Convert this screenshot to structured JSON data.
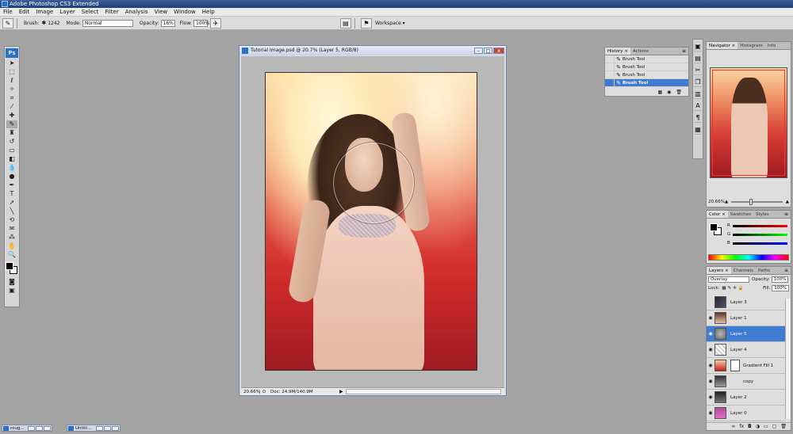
{
  "app": {
    "title": "Adobe Photoshop CS3 Extended"
  },
  "menu": [
    "File",
    "Edit",
    "Image",
    "Layer",
    "Select",
    "Filter",
    "Analysis",
    "View",
    "Window",
    "Help"
  ],
  "options": {
    "brush_label": "Brush:",
    "brush_size": "1242",
    "mode_label": "Mode:",
    "mode_value": "Normal",
    "opacity_label": "Opacity:",
    "opacity_value": "16%",
    "flow_label": "Flow:",
    "flow_value": "100%",
    "workspace_label": "Workspace ▾"
  },
  "toolbox": {
    "logo": "Ps"
  },
  "document": {
    "title": "Tutorial Image.psd @ 20.7% (Layer 5, RGB/8)",
    "zoom": "20.66%",
    "doc_size": "Doc: 24.9M/140.9M",
    "btn_min": "–",
    "btn_max": "□",
    "btn_close": "x"
  },
  "history": {
    "tabs": [
      "History ×",
      "Actions"
    ],
    "items": [
      {
        "label": "Brush Tool",
        "selected": false
      },
      {
        "label": "Brush Tool",
        "selected": false
      },
      {
        "label": "Brush Tool",
        "selected": false
      },
      {
        "label": "Brush Tool",
        "selected": true
      }
    ]
  },
  "navigator": {
    "tabs": [
      "Navigator ×",
      "Histogram",
      "Info"
    ],
    "zoom": "20.66%"
  },
  "color": {
    "tabs": [
      "Color ×",
      "Swatches",
      "Styles"
    ],
    "channels": [
      "R",
      "G",
      "B"
    ]
  },
  "layers": {
    "tabs": [
      "Layers ×",
      "Channels",
      "Paths"
    ],
    "blend_mode": "Overlay",
    "opacity_label": "Opacity:",
    "opacity_value": "100%",
    "lock_label": "Lock:",
    "fill_label": "Fill:",
    "fill_value": "100%",
    "items": [
      {
        "name": "Layer 3",
        "visible": false,
        "selected": false
      },
      {
        "name": "Layer 1",
        "visible": true,
        "selected": false
      },
      {
        "name": "Layer 5",
        "visible": true,
        "selected": true
      },
      {
        "name": "Layer 4",
        "visible": true,
        "selected": false
      },
      {
        "name": "Gradient Fill 1",
        "visible": true,
        "selected": false
      },
      {
        "name": "copy",
        "visible": true,
        "selected": false
      },
      {
        "name": "Layer 2",
        "visible": true,
        "selected": false
      },
      {
        "name": "Layer 0",
        "visible": true,
        "selected": false
      }
    ],
    "fx_label": "fx"
  },
  "taskbar": [
    {
      "label": "roug..."
    },
    {
      "label": "Untitl..."
    }
  ],
  "colors": {
    "accent": "#3e7bd1",
    "titlebar": "#1f3f77",
    "workspace": "#a4a4a4"
  }
}
